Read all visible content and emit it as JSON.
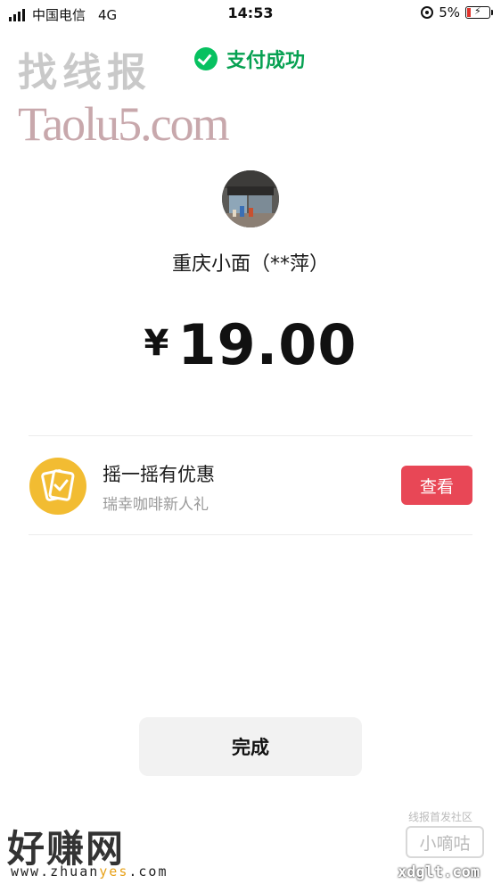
{
  "status_bar": {
    "carrier": "中国电信",
    "network": "4G",
    "time": "14:53",
    "battery": "5%"
  },
  "watermarks": {
    "top_cn": "找线报",
    "top_url": "Taolu5.com",
    "bottom_left_cn": "好赚网",
    "bottom_left_url_prefix": "www.zhuan",
    "bottom_left_url_highlight": "yes",
    "bottom_left_url_suffix": ".com",
    "bottom_right_top": "线报首发社区",
    "bottom_right_box": "小嘀咕",
    "bottom_right_url": "xdglt.com"
  },
  "header": {
    "pay_success": "支付成功",
    "icon": "wechat-check-icon",
    "accent": "#07c160"
  },
  "payment": {
    "merchant": "重庆小面（**萍）",
    "currency_symbol": "¥",
    "amount": "19.00"
  },
  "promo": {
    "title": "摇一摇有优惠",
    "subtitle": "瑞幸咖啡新人礼",
    "button": "查看",
    "button_color": "#e84756",
    "icon": "shake-cards-icon"
  },
  "footer": {
    "done": "完成"
  }
}
